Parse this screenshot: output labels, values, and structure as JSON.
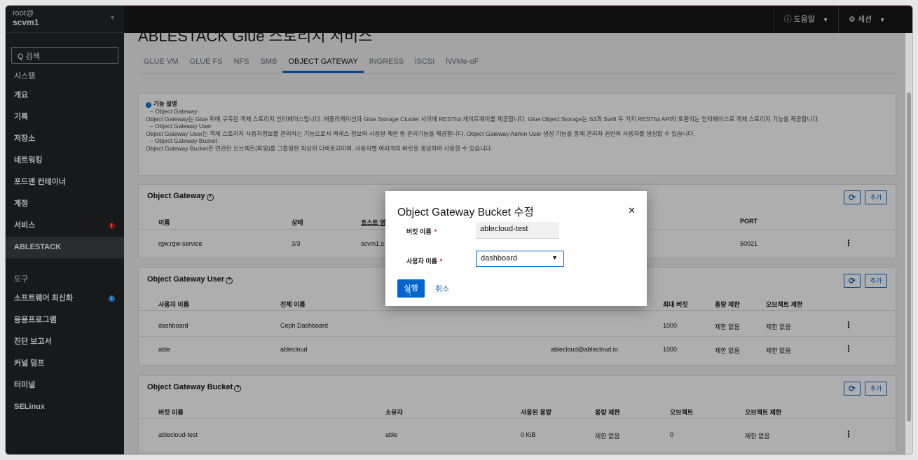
{
  "sidebar": {
    "host_user": "root@",
    "host_name": "scvm1",
    "search": "Q 검색",
    "section_system": "시스템",
    "items_system": [
      "개요",
      "기록",
      "저장소",
      "네트워킹",
      "포드맨 컨테이너",
      "계정",
      "서비스",
      "ABLESTACK"
    ],
    "section_tools": "도구",
    "items_tools": [
      "소프트웨어 최신화",
      "응용프로그램",
      "진단 보고서",
      "커널 덤프",
      "터미널",
      "SELinux"
    ]
  },
  "topbar": {
    "help": "도움말",
    "session": "세션"
  },
  "page": {
    "title": "ABLESTACK Glue 스토리지 서비스",
    "tabs": [
      "GLUE VM",
      "GLUE FS",
      "NFS",
      "SMB",
      "OBJECT GATEWAY",
      "INGRESS",
      "iSCSI",
      "NVMe-oF"
    ],
    "active_tab": "OBJECT GATEWAY"
  },
  "info": {
    "heading": "기능 설명",
    "lines": [
      "– Object Gateway",
      "Object Gateway는 Glue 위에 구축된 객체 스토리지 인터페이스입니다. 애플리케이션과 Glue Storage Cluster 사이에 RESTful 게이트웨이를 제공합니다. Glue Object Storage는 S3과 Swift 두 가지 RESTful API와 호환되는 인터페이스로 객체 스토리지 기능을 제공합니다.",
      "– Object Gateway User",
      "Object Gateway User는 객체 스토리지 사용자정보를 관리하는 기능으로서 액세스 정보와 사용량 제한 등 관리기능을 제공합니다. Object Gateway Admin User 생성 기능을 통해 관리자 권한의 사용자를 생성할 수 있습니다.",
      "– Object Gateway Bucket",
      "Object Gateway Bucket은 연관된 오브젝트(파일)를 그룹핑한 최상위 디렉토리이며, 사용자별 여러개의 버킷을 생성하여 사용할 수 있습니다."
    ]
  },
  "gateway": {
    "title": "Object Gateway",
    "add": "추가",
    "headers": [
      "이름",
      "상태",
      "호스트 명",
      "PORT"
    ],
    "row": [
      "rgw.rgw-service",
      "3/3",
      "scvm1,s",
      "50021"
    ]
  },
  "users": {
    "title": "Object Gateway User",
    "add": "추가",
    "headers": [
      "사용자 이름",
      "전체 이름",
      "최대 버킷",
      "용량 제한",
      "오브젝트 제한"
    ],
    "rows": [
      [
        "dashboard",
        "Ceph Dashboard",
        "",
        "1000",
        "제한 없음",
        "제한 없음"
      ],
      [
        "able",
        "ablecloud",
        "ablecloud@ablecloud.io",
        "1000",
        "제한 없음",
        "제한 없음"
      ]
    ]
  },
  "buckets": {
    "title": "Object Gateway Bucket",
    "add": "추가",
    "headers": [
      "버킷 이름",
      "소유자",
      "사용된 용량",
      "용량 제한",
      "오브젝트",
      "오브젝트 제한"
    ],
    "rows": [
      [
        "ablecloud-test",
        "able",
        "0 KiB",
        "제한 없음",
        "0",
        "제한 없음"
      ]
    ]
  },
  "modal": {
    "title": "Object Gateway Bucket 수정",
    "bucket_label": "버킷 이름",
    "bucket_value": "ablecloud-test",
    "user_label": "사용자 이름",
    "user_value": "dashboard",
    "run": "실행",
    "cancel": "취소"
  }
}
